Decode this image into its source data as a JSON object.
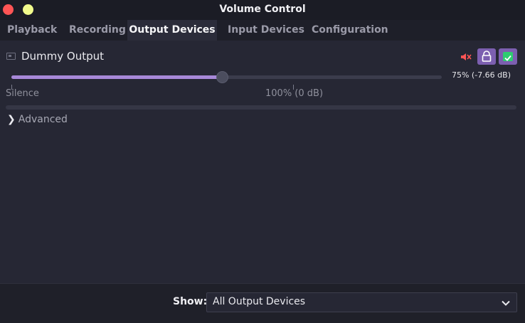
{
  "window": {
    "title": "Volume Control",
    "close_icon": "close-icon",
    "minimize_icon": "minimize-icon"
  },
  "tabs": [
    {
      "label": "Playback",
      "active": false
    },
    {
      "label": "Recording",
      "active": false
    },
    {
      "label": "Output Devices",
      "active": true
    },
    {
      "label": "Input Devices",
      "active": false
    },
    {
      "label": "Configuration",
      "active": false
    }
  ],
  "device": {
    "name": "Dummy Output",
    "icon": "sound-card-icon",
    "volume_fraction": 0.49,
    "volume_readout": "75% (-7.66 dB)",
    "mute_icon": "speaker-mute-icon",
    "lock_icon": "lock-channels-icon",
    "default_icon": "default-check-icon",
    "scale_labels": {
      "min": "Silence",
      "mid": "100% (0 dB)"
    },
    "advanced_label": "Advanced"
  },
  "bottom": {
    "show_label": "Show:",
    "show_value": "All Output Devices"
  },
  "colors": {
    "accent": "#a788d8",
    "button_bg": "#7c5fb0",
    "mute_red": "#ff5555",
    "check_green": "#2ecc71"
  }
}
